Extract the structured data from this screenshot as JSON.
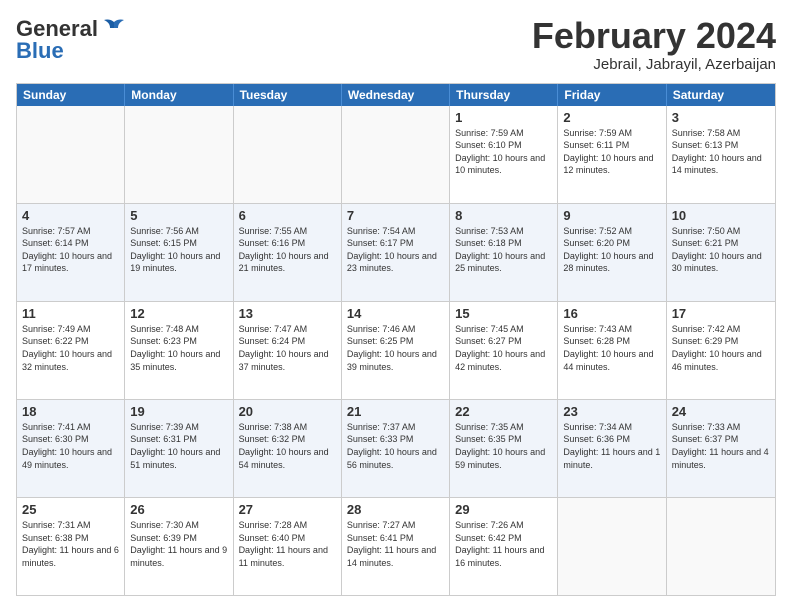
{
  "logo": {
    "line1": "General",
    "line2": "Blue"
  },
  "title": "February 2024",
  "subtitle": "Jebrail, Jabrayil, Azerbaijan",
  "days_of_week": [
    "Sunday",
    "Monday",
    "Tuesday",
    "Wednesday",
    "Thursday",
    "Friday",
    "Saturday"
  ],
  "weeks": [
    [
      {
        "day": "",
        "empty": true
      },
      {
        "day": "",
        "empty": true
      },
      {
        "day": "",
        "empty": true
      },
      {
        "day": "",
        "empty": true
      },
      {
        "day": "1",
        "sunrise": "7:59 AM",
        "sunset": "6:10 PM",
        "daylight": "10 hours and 10 minutes."
      },
      {
        "day": "2",
        "sunrise": "7:59 AM",
        "sunset": "6:11 PM",
        "daylight": "10 hours and 12 minutes."
      },
      {
        "day": "3",
        "sunrise": "7:58 AM",
        "sunset": "6:13 PM",
        "daylight": "10 hours and 14 minutes."
      }
    ],
    [
      {
        "day": "4",
        "sunrise": "7:57 AM",
        "sunset": "6:14 PM",
        "daylight": "10 hours and 17 minutes."
      },
      {
        "day": "5",
        "sunrise": "7:56 AM",
        "sunset": "6:15 PM",
        "daylight": "10 hours and 19 minutes."
      },
      {
        "day": "6",
        "sunrise": "7:55 AM",
        "sunset": "6:16 PM",
        "daylight": "10 hours and 21 minutes."
      },
      {
        "day": "7",
        "sunrise": "7:54 AM",
        "sunset": "6:17 PM",
        "daylight": "10 hours and 23 minutes."
      },
      {
        "day": "8",
        "sunrise": "7:53 AM",
        "sunset": "6:18 PM",
        "daylight": "10 hours and 25 minutes."
      },
      {
        "day": "9",
        "sunrise": "7:52 AM",
        "sunset": "6:20 PM",
        "daylight": "10 hours and 28 minutes."
      },
      {
        "day": "10",
        "sunrise": "7:50 AM",
        "sunset": "6:21 PM",
        "daylight": "10 hours and 30 minutes."
      }
    ],
    [
      {
        "day": "11",
        "sunrise": "7:49 AM",
        "sunset": "6:22 PM",
        "daylight": "10 hours and 32 minutes."
      },
      {
        "day": "12",
        "sunrise": "7:48 AM",
        "sunset": "6:23 PM",
        "daylight": "10 hours and 35 minutes."
      },
      {
        "day": "13",
        "sunrise": "7:47 AM",
        "sunset": "6:24 PM",
        "daylight": "10 hours and 37 minutes."
      },
      {
        "day": "14",
        "sunrise": "7:46 AM",
        "sunset": "6:25 PM",
        "daylight": "10 hours and 39 minutes."
      },
      {
        "day": "15",
        "sunrise": "7:45 AM",
        "sunset": "6:27 PM",
        "daylight": "10 hours and 42 minutes."
      },
      {
        "day": "16",
        "sunrise": "7:43 AM",
        "sunset": "6:28 PM",
        "daylight": "10 hours and 44 minutes."
      },
      {
        "day": "17",
        "sunrise": "7:42 AM",
        "sunset": "6:29 PM",
        "daylight": "10 hours and 46 minutes."
      }
    ],
    [
      {
        "day": "18",
        "sunrise": "7:41 AM",
        "sunset": "6:30 PM",
        "daylight": "10 hours and 49 minutes."
      },
      {
        "day": "19",
        "sunrise": "7:39 AM",
        "sunset": "6:31 PM",
        "daylight": "10 hours and 51 minutes."
      },
      {
        "day": "20",
        "sunrise": "7:38 AM",
        "sunset": "6:32 PM",
        "daylight": "10 hours and 54 minutes."
      },
      {
        "day": "21",
        "sunrise": "7:37 AM",
        "sunset": "6:33 PM",
        "daylight": "10 hours and 56 minutes."
      },
      {
        "day": "22",
        "sunrise": "7:35 AM",
        "sunset": "6:35 PM",
        "daylight": "10 hours and 59 minutes."
      },
      {
        "day": "23",
        "sunrise": "7:34 AM",
        "sunset": "6:36 PM",
        "daylight": "11 hours and 1 minute."
      },
      {
        "day": "24",
        "sunrise": "7:33 AM",
        "sunset": "6:37 PM",
        "daylight": "11 hours and 4 minutes."
      }
    ],
    [
      {
        "day": "25",
        "sunrise": "7:31 AM",
        "sunset": "6:38 PM",
        "daylight": "11 hours and 6 minutes."
      },
      {
        "day": "26",
        "sunrise": "7:30 AM",
        "sunset": "6:39 PM",
        "daylight": "11 hours and 9 minutes."
      },
      {
        "day": "27",
        "sunrise": "7:28 AM",
        "sunset": "6:40 PM",
        "daylight": "11 hours and 11 minutes."
      },
      {
        "day": "28",
        "sunrise": "7:27 AM",
        "sunset": "6:41 PM",
        "daylight": "11 hours and 14 minutes."
      },
      {
        "day": "29",
        "sunrise": "7:26 AM",
        "sunset": "6:42 PM",
        "daylight": "11 hours and 16 minutes."
      },
      {
        "day": "",
        "empty": true
      },
      {
        "day": "",
        "empty": true
      }
    ]
  ]
}
